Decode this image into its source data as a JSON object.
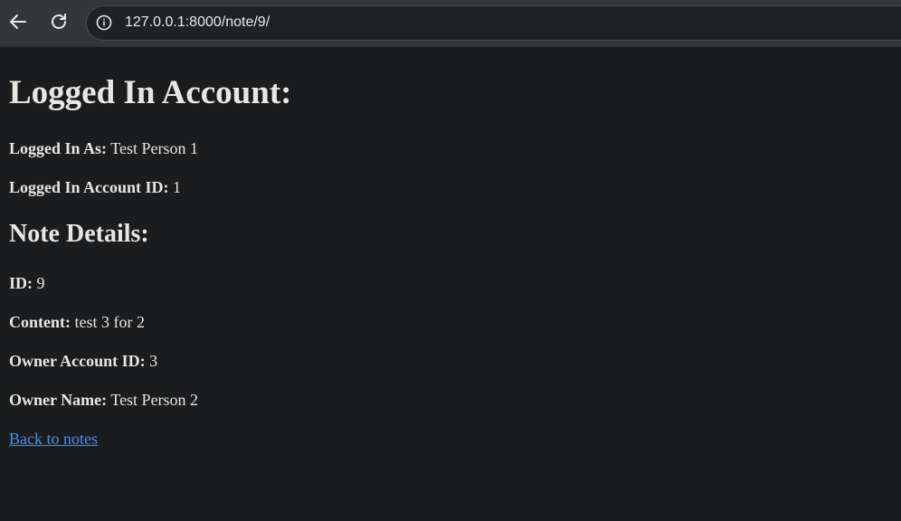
{
  "browser": {
    "url": "127.0.0.1:8000/note/9/"
  },
  "account": {
    "heading": "Logged In Account:",
    "logged_in_as_label": "Logged In As:",
    "logged_in_as_value": "Test Person 1",
    "account_id_label": "Logged In Account ID:",
    "account_id_value": "1"
  },
  "note": {
    "heading": "Note Details:",
    "id_label": "ID:",
    "id_value": "9",
    "content_label": "Content:",
    "content_value": "test 3 for 2",
    "owner_id_label": "Owner Account ID:",
    "owner_id_value": "3",
    "owner_name_label": "Owner Name:",
    "owner_name_value": "Test Person 2"
  },
  "links": {
    "back_label": "Back to notes"
  },
  "colors": {
    "page_background": "#1b1c1e",
    "text": "#e8e6e3",
    "link": "#4a90e2",
    "toolbar": "#35363a"
  }
}
